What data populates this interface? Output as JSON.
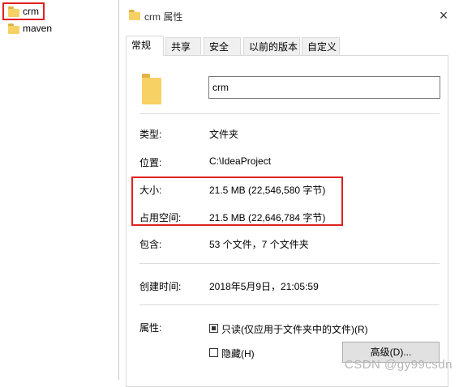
{
  "explorer": {
    "items": [
      {
        "label": "crm"
      },
      {
        "label": "maven"
      }
    ]
  },
  "dialog": {
    "title": "crm 属性",
    "close_glyph": "×",
    "tabs": [
      {
        "label": "常规",
        "active": true
      },
      {
        "label": "共享"
      },
      {
        "label": "安全"
      },
      {
        "label": "以前的版本"
      },
      {
        "label": "自定义"
      }
    ],
    "name_value": "crm",
    "fields": {
      "type_label": "类型:",
      "type_value": "文件夹",
      "location_label": "位置:",
      "location_value": "C:\\IdeaProject",
      "size_label": "大小:",
      "size_value": "21.5 MB (22,546,580 字节)",
      "disk_size_label": "占用空间:",
      "disk_size_value": "21.5 MB (22,646,784 字节)",
      "contains_label": "包含:",
      "contains_value": "53 个文件，7 个文件夹",
      "created_label": "创建时间:",
      "created_value": "2018年5月9日，21:05:59",
      "attributes_label": "属性:"
    },
    "attributes": {
      "readonly_label": "只读(仅应用于文件夹中的文件)(R)",
      "readonly_state": "indeterminate",
      "hidden_label": "隐藏(H)",
      "hidden_checked": false,
      "advanced_button": "高级(D)..."
    }
  },
  "watermark": "CSDN @gy99csdn",
  "colors": {
    "highlight_border": "#e02020",
    "folder": "#f8d165",
    "folder_dark": "#e2b342"
  }
}
